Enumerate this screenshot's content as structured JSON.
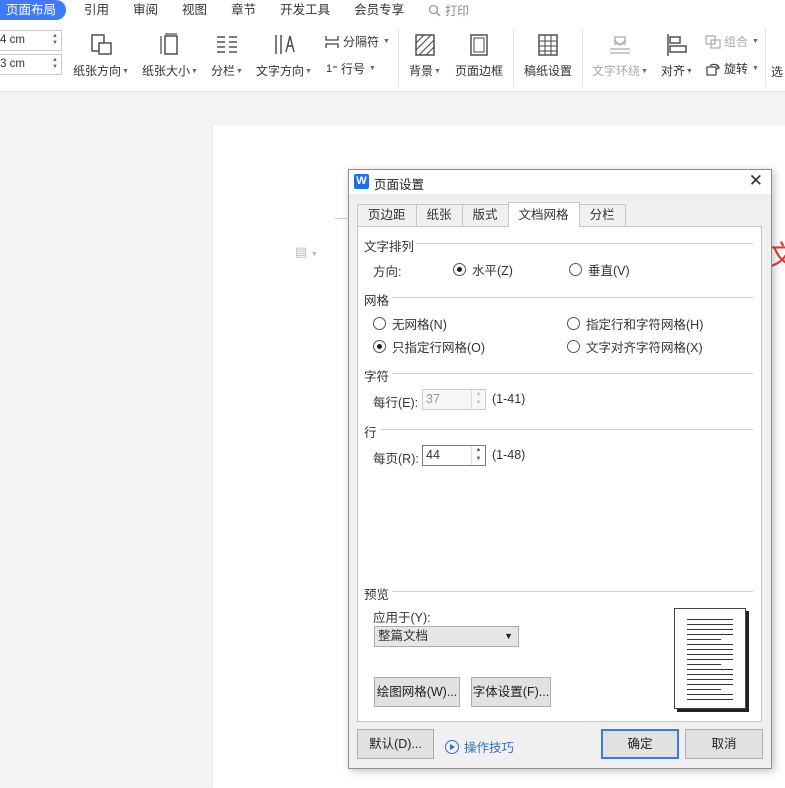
{
  "menu": {
    "items": [
      "页面布局",
      "引用",
      "审阅",
      "视图",
      "章节",
      "开发工具",
      "会员专享"
    ],
    "search_label": "打印"
  },
  "ribbon": {
    "spin1_value": "4 cm",
    "spin2_value": "3 cm",
    "paper_orientation": "纸张方向",
    "paper_size": "纸张大小",
    "columns": "分栏",
    "text_direction": "文字方向",
    "separator": "分隔符",
    "line_number": "行号",
    "background": "背景",
    "page_border": "页面边框",
    "manuscript_setup": "稿纸设置",
    "text_wrap": "文字环绕",
    "align": "对齐",
    "group": "组合",
    "rotate": "旋转",
    "select": "选"
  },
  "document": {
    "red_char": "文"
  },
  "dialog": {
    "title": "页面设置",
    "tabs": [
      "页边距",
      "纸张",
      "版式",
      "文档网格",
      "分栏"
    ],
    "active_tab": "文档网格",
    "text_arrangement": {
      "label": "文字排列",
      "direction_label": "方向:",
      "horizontal": "水平(Z)",
      "vertical": "垂直(V)",
      "selected": "horizontal"
    },
    "grid": {
      "label": "网格",
      "no_grid": "无网格(N)",
      "line_only": "只指定行网格(O)",
      "line_and_char": "指定行和字符网格(H)",
      "snap_to_char": "文字对齐字符网格(X)",
      "selected": "line_only"
    },
    "chars": {
      "label": "字符",
      "per_line_label": "每行(E):",
      "per_line_value": "37",
      "range": "(1-41)"
    },
    "lines": {
      "label": "行",
      "per_page_label": "每页(R):",
      "per_page_value": "44",
      "range": "(1-48)"
    },
    "preview": {
      "label": "预览",
      "apply_to_label": "应用于(Y):",
      "apply_to_value": "整篇文档"
    },
    "buttons": {
      "drawing_grid": "绘图网格(W)...",
      "font_settings": "字体设置(F)...",
      "default": "默认(D)...",
      "tips": "操作技巧",
      "ok": "确定",
      "cancel": "取消"
    }
  },
  "colors": {
    "accent": "#3d7bf7",
    "dialog_bg": "#f0f0f0",
    "red_text": "#e53935",
    "link": "#2f6fd0"
  }
}
